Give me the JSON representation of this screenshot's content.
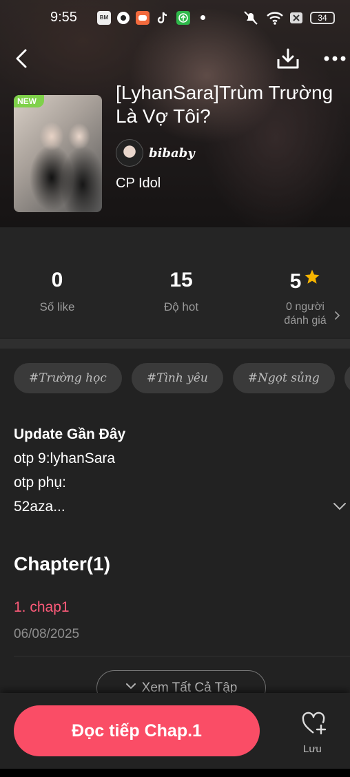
{
  "status_bar": {
    "time": "9:55",
    "battery": "34",
    "app_icons": [
      "baomoi-icon",
      "shazam-icon",
      "game-icon",
      "tiktok-icon",
      "upload-app-icon"
    ]
  },
  "header": {
    "badge": "NEW",
    "title": "[LyhanSara]Trùm Trường Là Vợ Tôi?",
    "title_line1": "[LyhanSara]Trùm Trường",
    "title_line2": "Là Vợ Tôi?",
    "author": "bibaby",
    "category": "CP Idol"
  },
  "stats": {
    "likes_value": "0",
    "likes_label": "Số like",
    "hot_value": "15",
    "hot_label": "Độ hot",
    "rating_value": "5",
    "rating_label_line1": "0 người",
    "rating_label_line2": "đánh giá"
  },
  "tags": [
    "#Trường học",
    "#Tình yêu",
    "#Ngọt sủng"
  ],
  "description": {
    "heading": "Update Gần Đây",
    "lines": [
      "otp 9:lyhanSara",
      "otp phụ:",
      "52aza..."
    ]
  },
  "chapters": {
    "heading": "Chapter(1)",
    "items": [
      {
        "title": "1. chap1",
        "date": "06/08/2025"
      }
    ],
    "see_all": "Xem Tất Cả Tập"
  },
  "bottom": {
    "cta": "Đọc tiếp Chap.1",
    "save_label": "Lưu"
  },
  "colors": {
    "accent": "#fa4d66",
    "chapter_title": "#ff5b7a",
    "star": "#f7b500",
    "new_badge": "#7fd14a"
  }
}
